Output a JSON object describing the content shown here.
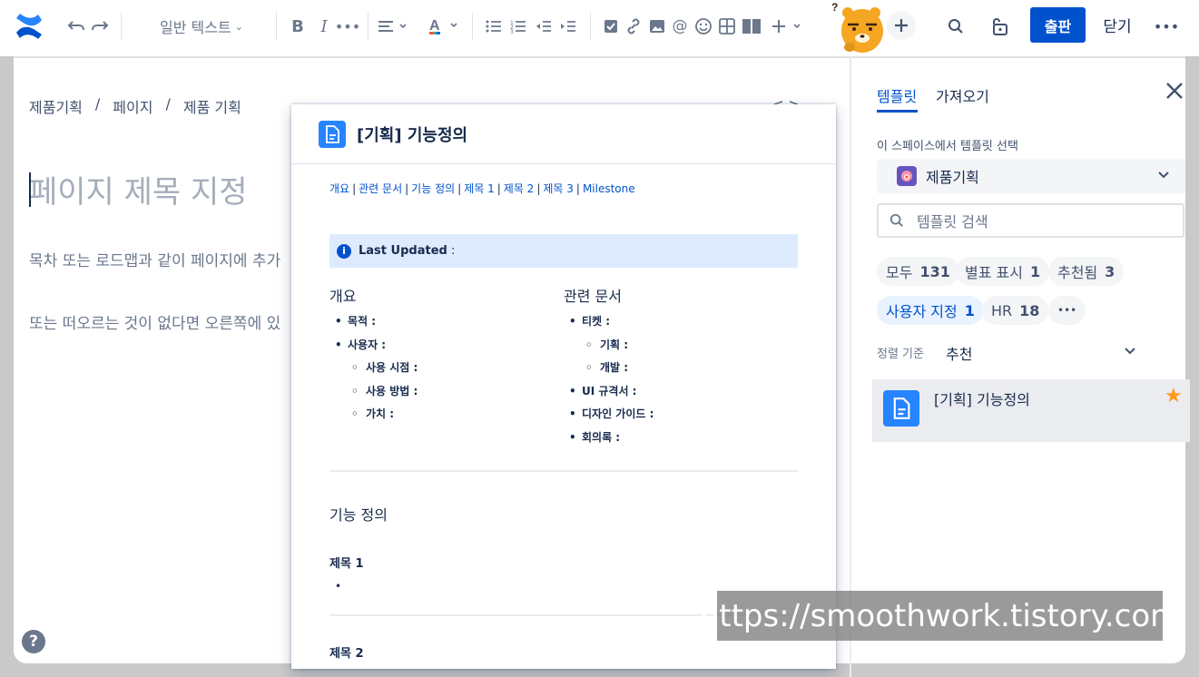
{
  "toolbar": {
    "text_style": "일반 텍스트",
    "publish": "출판",
    "close": "닫기"
  },
  "breadcrumb": [
    "제품기획",
    "/",
    "페이지",
    "/",
    "제품 기획"
  ],
  "editor": {
    "title_placeholder": "페이지 제목 지정",
    "line1": "목차 또는 로드맵과 같이 페이지에 추가",
    "line2": "또는 떠오르는 것이 없다면 오른쪽에 있"
  },
  "preview": {
    "title": "[기획] 기능정의",
    "links": [
      "개요",
      "관련 문서",
      "기능 정의",
      "제목 1",
      "제목 2",
      "제목 3",
      "Milestone"
    ],
    "link_sep": "|",
    "info_panel": "Last Updated",
    "info_colon": " :",
    "col1": {
      "heading": "개요",
      "items": [
        {
          "text": "목적 :",
          "level": 1
        },
        {
          "text": "사용자 :",
          "level": 1
        },
        {
          "text": "사용 시점 :",
          "level": 2
        },
        {
          "text": "사용 방법 :",
          "level": 2
        },
        {
          "text": "가치 :",
          "level": 2
        }
      ]
    },
    "col2": {
      "heading": "관련 문서",
      "items": [
        {
          "text": "티켓 :",
          "level": 1
        },
        {
          "text": "기획 :",
          "level": 2
        },
        {
          "text": "개발 :",
          "level": 2
        },
        {
          "text": "UI 규격서 :",
          "level": 1
        },
        {
          "text": "디자인 가이드 :",
          "level": 1
        },
        {
          "text": "회의록 :",
          "level": 1
        }
      ]
    },
    "section_title": "기능 정의",
    "h_one": "제목 1",
    "bullet": "•",
    "h_two": "제목 2"
  },
  "panel": {
    "tab_templates": "템플릿",
    "tab_import": "가져오기",
    "space_label": "이 스페이스에서 템플릿 선택",
    "space_value": "제품기획",
    "search_placeholder": "템플릿 검색",
    "chips": [
      {
        "label": "모두",
        "count": "131"
      },
      {
        "label": "별표 표시",
        "count": "1"
      },
      {
        "label": "추천됨",
        "count": "3"
      },
      {
        "label": "사용자 지정",
        "count": "1"
      },
      {
        "label": "HR",
        "count": "18"
      },
      {
        "label": "•••",
        "count": ""
      }
    ],
    "sort_label": "정렬 기준",
    "sort_value": "추천",
    "template_name": "[기획] 기능정의"
  },
  "watermark": "https://smoothwork.tistory.com",
  "colors": {
    "primary": "#0052cc",
    "template_icon": "#2684ff",
    "star": "#ff991f",
    "info_bg": "#deebff"
  }
}
